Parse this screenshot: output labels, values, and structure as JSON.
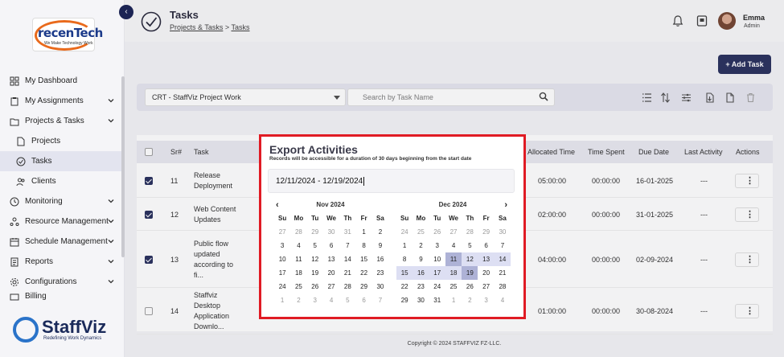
{
  "app": {
    "logo_text": "recenTech",
    "logo_tagline": "We Make Technology Work",
    "brand_name": "StaffViz",
    "brand_tagline": "Redefining Work Dynamics"
  },
  "sidebar": {
    "items": [
      {
        "label": "My Dashboard",
        "icon": "dashboard-icon"
      },
      {
        "label": "My Assignments",
        "icon": "clipboard-icon",
        "expandable": true
      },
      {
        "label": "Projects & Tasks",
        "icon": "projects-icon",
        "expandable": true
      },
      {
        "label": "Projects",
        "icon": "document-icon",
        "sub": true
      },
      {
        "label": "Tasks",
        "icon": "check-circle-icon",
        "sub": true,
        "active": true
      },
      {
        "label": "Clients",
        "icon": "users-icon",
        "sub": true
      },
      {
        "label": "Monitoring",
        "icon": "monitoring-icon",
        "expandable": true
      },
      {
        "label": "Resource Management",
        "icon": "resource-icon",
        "expandable": true
      },
      {
        "label": "Schedule Management",
        "icon": "schedule-icon",
        "expandable": true
      },
      {
        "label": "Reports",
        "icon": "reports-icon",
        "expandable": true
      },
      {
        "label": "Configurations",
        "icon": "gear-icon",
        "expandable": true
      },
      {
        "label": "Billing",
        "icon": "billing-icon"
      }
    ]
  },
  "header": {
    "title": "Tasks",
    "breadcrumb": [
      "Projects & Tasks",
      "Tasks"
    ],
    "breadcrumb_sep": ">",
    "user_name": "Emma",
    "user_role": "Admin"
  },
  "toolbar": {
    "add_task_label": "+ Add Task",
    "project_selected": "CRT - StaffViz Project Work",
    "search_placeholder": "Search by Task Name"
  },
  "table": {
    "headers": {
      "sr": "Sr#",
      "task": "Task",
      "allocated": "Allocated Time",
      "spent": "Time Spent",
      "due": "Due Date",
      "last": "Last Activity",
      "actions": "Actions"
    },
    "rows": [
      {
        "sr": "11",
        "task": [
          "Release",
          "Deployment"
        ],
        "allocated": "05:00:00",
        "spent": "00:00:00",
        "due": "16-01-2025",
        "last": "---",
        "checked": true
      },
      {
        "sr": "12",
        "task": [
          "Web Content",
          "Updates"
        ],
        "allocated": "02:00:00",
        "spent": "00:00:00",
        "due": "31-01-2025",
        "last": "---",
        "checked": true
      },
      {
        "sr": "13",
        "task": [
          "Public flow",
          "updated",
          "according to",
          "fi..."
        ],
        "allocated": "04:00:00",
        "spent": "00:00:00",
        "due": "02-09-2024",
        "last": "---",
        "checked": true
      },
      {
        "sr": "14",
        "task": [
          "Staffviz",
          "Desktop",
          "Application",
          "Downlo..."
        ],
        "allocated": "01:00:00",
        "spent": "00:00:00",
        "due": "30-08-2024",
        "last": "---",
        "checked": false
      }
    ]
  },
  "footer": {
    "copyright": "Copyright © 2024 STAFFVIZ FZ-LLC."
  },
  "modal": {
    "title": "Export Activities",
    "subtitle": "Records will be accessible for a duration of 30 days beginning from the start date",
    "date_range_value": "12/11/2024 - 12/19/2024",
    "weekdays": [
      "Su",
      "Mo",
      "Tu",
      "We",
      "Th",
      "Fr",
      "Sa"
    ],
    "calendars": [
      {
        "month_label": "Nov 2024",
        "days": [
          {
            "d": "27",
            "m": true
          },
          {
            "d": "28",
            "m": true
          },
          {
            "d": "29",
            "m": true
          },
          {
            "d": "30",
            "m": true
          },
          {
            "d": "31",
            "m": true
          },
          {
            "d": "1"
          },
          {
            "d": "2"
          },
          {
            "d": "3"
          },
          {
            "d": "4"
          },
          {
            "d": "5"
          },
          {
            "d": "6"
          },
          {
            "d": "7"
          },
          {
            "d": "8"
          },
          {
            "d": "9"
          },
          {
            "d": "10"
          },
          {
            "d": "11"
          },
          {
            "d": "12"
          },
          {
            "d": "13"
          },
          {
            "d": "14"
          },
          {
            "d": "15"
          },
          {
            "d": "16"
          },
          {
            "d": "17"
          },
          {
            "d": "18"
          },
          {
            "d": "19"
          },
          {
            "d": "20"
          },
          {
            "d": "21"
          },
          {
            "d": "22"
          },
          {
            "d": "23"
          },
          {
            "d": "24"
          },
          {
            "d": "25"
          },
          {
            "d": "26"
          },
          {
            "d": "27"
          },
          {
            "d": "28"
          },
          {
            "d": "29"
          },
          {
            "d": "30"
          },
          {
            "d": "1",
            "m": true
          },
          {
            "d": "2",
            "m": true
          },
          {
            "d": "3",
            "m": true
          },
          {
            "d": "4",
            "m": true
          },
          {
            "d": "5",
            "m": true
          },
          {
            "d": "6",
            "m": true
          },
          {
            "d": "7",
            "m": true
          }
        ]
      },
      {
        "month_label": "Dec 2024",
        "days": [
          {
            "d": "24",
            "m": true
          },
          {
            "d": "25",
            "m": true
          },
          {
            "d": "26",
            "m": true
          },
          {
            "d": "27",
            "m": true
          },
          {
            "d": "28",
            "m": true
          },
          {
            "d": "29",
            "m": true
          },
          {
            "d": "30",
            "m": true
          },
          {
            "d": "1"
          },
          {
            "d": "2"
          },
          {
            "d": "3"
          },
          {
            "d": "4"
          },
          {
            "d": "5"
          },
          {
            "d": "6"
          },
          {
            "d": "7"
          },
          {
            "d": "8"
          },
          {
            "d": "9"
          },
          {
            "d": "10"
          },
          {
            "d": "11",
            "s": "edge"
          },
          {
            "d": "12",
            "s": "range"
          },
          {
            "d": "13",
            "s": "range"
          },
          {
            "d": "14",
            "s": "range"
          },
          {
            "d": "15",
            "s": "range"
          },
          {
            "d": "16",
            "s": "range"
          },
          {
            "d": "17",
            "s": "range"
          },
          {
            "d": "18",
            "s": "range"
          },
          {
            "d": "19",
            "s": "edge"
          },
          {
            "d": "20"
          },
          {
            "d": "21"
          },
          {
            "d": "22"
          },
          {
            "d": "23"
          },
          {
            "d": "24"
          },
          {
            "d": "25"
          },
          {
            "d": "26"
          },
          {
            "d": "27"
          },
          {
            "d": "28"
          },
          {
            "d": "29"
          },
          {
            "d": "30"
          },
          {
            "d": "31"
          },
          {
            "d": "1",
            "m": true
          },
          {
            "d": "2",
            "m": true
          },
          {
            "d": "3",
            "m": true
          },
          {
            "d": "4",
            "m": true
          }
        ]
      }
    ]
  },
  "colors": {
    "primary": "#1c2454",
    "highlight": "#e01b24",
    "range": "#dddff3",
    "range_edge": "#aeb2d6"
  }
}
